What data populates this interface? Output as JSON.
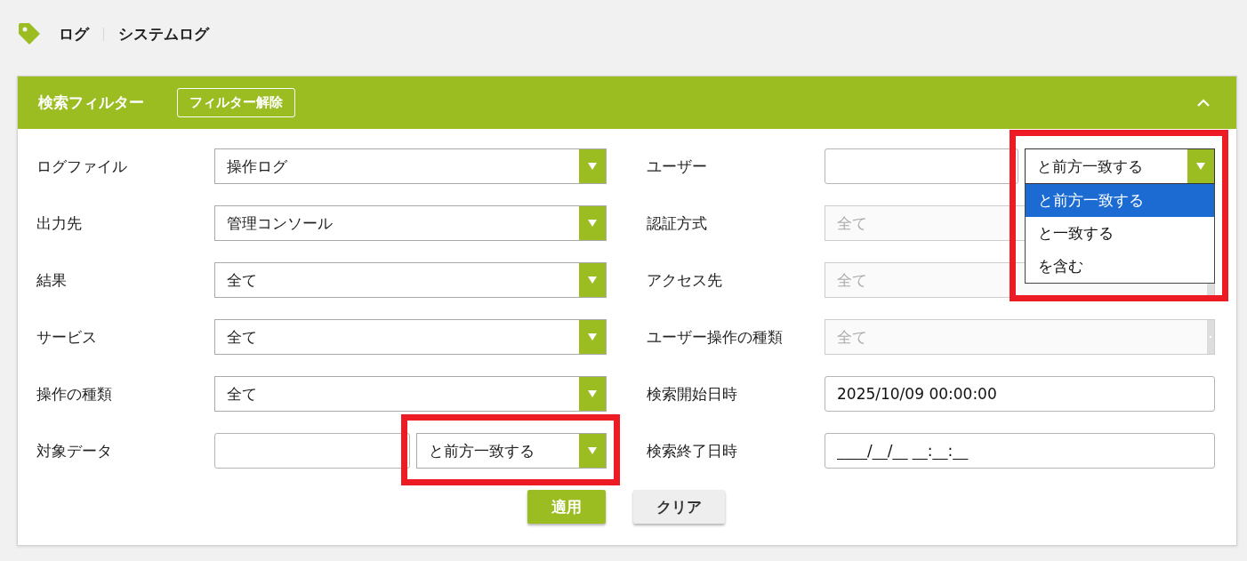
{
  "breadcrumb": {
    "items": [
      "ログ",
      "システムログ"
    ]
  },
  "filter_panel": {
    "title": "検索フィルター",
    "clear_button": "フィルター解除",
    "expanded": true,
    "rows": [
      {
        "fields": [
          {
            "label": "ログファイル",
            "kind": "select",
            "value": "操作ログ",
            "disabled": false
          },
          {
            "label": "ユーザー",
            "kind": "text-match",
            "match": {
              "value": "と前方一致する",
              "expanded": true,
              "highlighted": true,
              "options": [
                {
                  "label": "と前方一致する",
                  "selected": true
                },
                {
                  "label": "と一致する",
                  "selected": false
                },
                {
                  "label": "を含む",
                  "selected": false
                }
              ]
            }
          }
        ]
      },
      {
        "fields": [
          {
            "label": "出力先",
            "kind": "select",
            "value": "管理コンソール",
            "disabled": false
          },
          {
            "label": "認証方式",
            "kind": "select",
            "value": "全て",
            "disabled": true
          }
        ]
      },
      {
        "fields": [
          {
            "label": "結果",
            "kind": "select",
            "value": "全て",
            "disabled": false
          },
          {
            "label": "アクセス先",
            "kind": "select",
            "value": "全て",
            "disabled": true
          }
        ]
      },
      {
        "fields": [
          {
            "label": "サービス",
            "kind": "select",
            "value": "全て",
            "disabled": false
          },
          {
            "label": "ユーザー操作の種類",
            "kind": "select",
            "value": "全て",
            "disabled": true
          }
        ]
      },
      {
        "fields": [
          {
            "label": "操作の種類",
            "kind": "select",
            "value": "全て",
            "disabled": false
          },
          {
            "label": "検索開始日時",
            "kind": "text",
            "value": "2025/10/09 00:00:00"
          }
        ]
      },
      {
        "fields": [
          {
            "label": "対象データ",
            "kind": "text-match",
            "match": {
              "value": "と前方一致する",
              "expanded": false,
              "highlighted": true
            }
          },
          {
            "label": "検索終了日時",
            "kind": "text",
            "value": "____/__/__ __:__:__"
          }
        ]
      }
    ],
    "buttons": [
      {
        "label": "適用",
        "kind": "primary"
      },
      {
        "label": "クリア",
        "kind": "secondary"
      }
    ]
  }
}
